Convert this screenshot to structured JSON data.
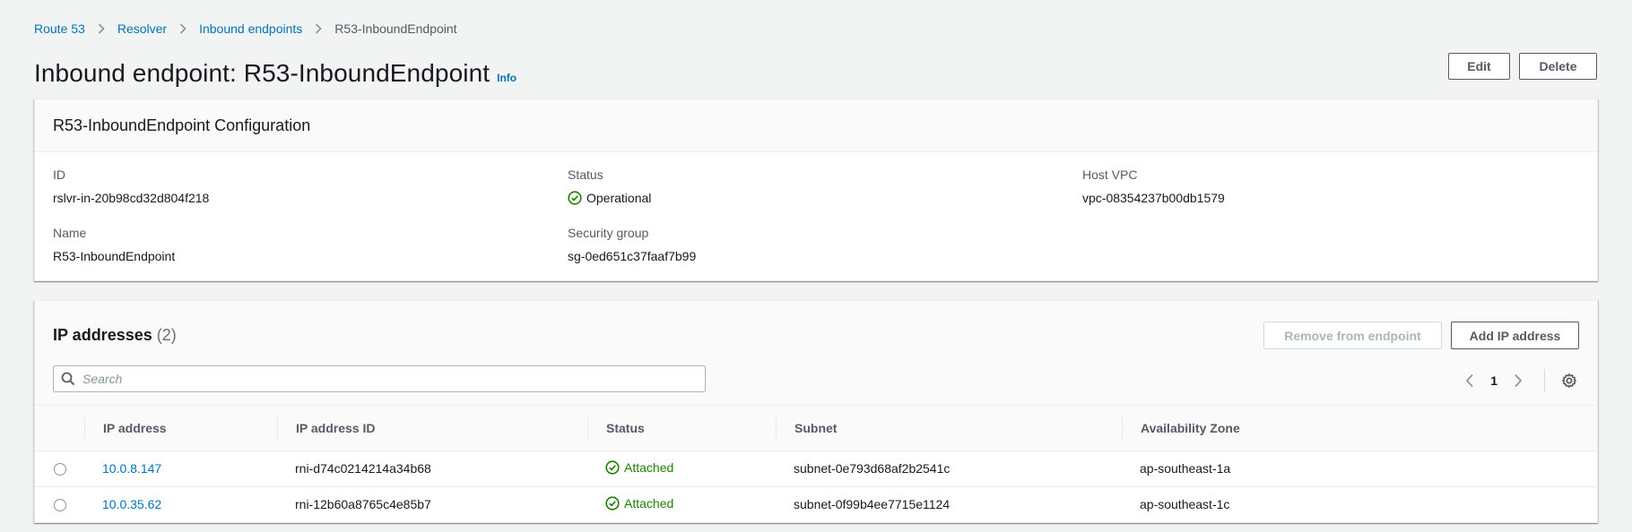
{
  "breadcrumb": {
    "items": [
      "Route 53",
      "Resolver",
      "Inbound endpoints"
    ],
    "current": "R53-InboundEndpoint"
  },
  "header": {
    "title": "Inbound endpoint: R53-InboundEndpoint",
    "info_label": "Info",
    "edit_label": "Edit",
    "delete_label": "Delete"
  },
  "config": {
    "title": "R53-InboundEndpoint Configuration",
    "id_label": "ID",
    "id_value": "rslvr-in-20b98cd32d804f218",
    "name_label": "Name",
    "name_value": "R53-InboundEndpoint",
    "status_label": "Status",
    "status_value": "Operational",
    "sg_label": "Security group",
    "sg_value": "sg-0ed651c37faaf7b99",
    "vpc_label": "Host VPC",
    "vpc_value": "vpc-08354237b00db1579"
  },
  "ip_addresses": {
    "title": "IP addresses",
    "count": "(2)",
    "remove_label": "Remove from endpoint",
    "add_label": "Add IP address",
    "search_placeholder": "Search",
    "page": "1",
    "columns": [
      "IP address",
      "IP address ID",
      "Status",
      "Subnet",
      "Availability Zone"
    ],
    "rows": [
      {
        "ip": "10.0.8.147",
        "id": "rni-d74c0214214a34b68",
        "status": "Attached",
        "subnet": "subnet-0e793d68af2b2541c",
        "az": "ap-southeast-1a"
      },
      {
        "ip": "10.0.35.62",
        "id": "rni-12b60a8765c4e85b7",
        "status": "Attached",
        "subnet": "subnet-0f99b4ee7715e1124",
        "az": "ap-southeast-1c"
      }
    ]
  },
  "colors": {
    "link": "#0073bb",
    "success": "#1d8102",
    "background": "#f2f3f3"
  },
  "icons": [
    "chevron-right-icon",
    "status-success-icon",
    "search-icon",
    "chevron-left-icon",
    "settings-gear-icon"
  ]
}
